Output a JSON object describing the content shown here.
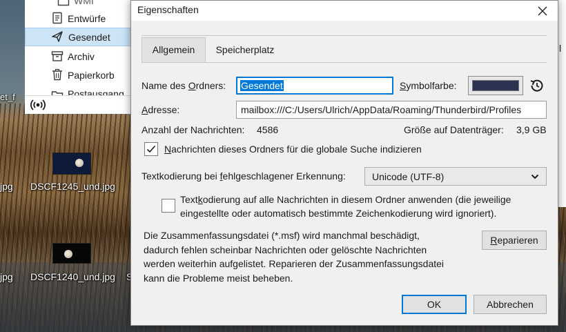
{
  "folder_pane": {
    "items": [
      {
        "label": "WMI",
        "icon": "folder-icon"
      },
      {
        "label": "Entwürfe",
        "icon": "drafts-icon"
      },
      {
        "label": "Gesendet",
        "icon": "send-icon",
        "selected": true
      },
      {
        "label": "Archiv",
        "icon": "archive-icon"
      },
      {
        "label": "Papierkorb",
        "icon": "trash-icon"
      },
      {
        "label": "Postausgang",
        "icon": "outbox-folder-icon"
      }
    ],
    "status_icon": "online-status-icon",
    "selected_color": "#cde4f7"
  },
  "desktop": {
    "icons": [
      {
        "label": "DSCF1245_und.jpg"
      },
      {
        "label": "DSCF1240_und.jpg"
      }
    ],
    "edge_labels": {
      "left_top": "et_f",
      "left_mid": "jpg",
      "left_bottom": "jpg",
      "s_fragment": "S"
    }
  },
  "bg_window": {
    "fragment": "l"
  },
  "dialog": {
    "title": "Eigenschaften",
    "close_icon": "close-icon",
    "tabs": [
      {
        "label": "Allgemein",
        "active": true
      },
      {
        "label": "Speicherplatz",
        "active": false
      }
    ],
    "name": {
      "label_pre": "Name des ",
      "label_accel": "O",
      "label_post": "rdners:",
      "value": "Gesendet"
    },
    "symbol_color": {
      "label_accel": "S",
      "label_post": "ymbolfarbe:",
      "value": "#2b3350",
      "reset_icon": "history-reset-icon"
    },
    "address": {
      "label_accel": "A",
      "label_post": "dresse:",
      "value": "mailbox:///C:/Users/Ulrich/AppData/Roaming/Thunderbird/Profiles"
    },
    "message_count": {
      "label": "Anzahl der Nachrichten:",
      "value": "4586"
    },
    "disk_size": {
      "label": "Größe auf Datenträger:",
      "value": "3,9 GB"
    },
    "index_checkbox": {
      "checked": true,
      "label_accel": "N",
      "label_post": "achrichten dieses Ordners für die globale Suche indizieren",
      "check_icon": "checkmark-icon"
    },
    "encoding": {
      "label_pre": "Textkodierung bei ",
      "label_accel": "f",
      "label_post": "ehlgeschlagener Erkennung:",
      "selected": "Unicode (UTF-8)",
      "chevron_icon": "chevron-down-icon"
    },
    "apply_encoding": {
      "checked": false,
      "line1_pre": "Text",
      "line1_accel": "k",
      "line1_post": "odierung auf alle Nachrichten in diesem Ordner anwenden (die jeweilige",
      "line2": "eingestellte oder automatisch bestimmte Zeichenkodierung wird ignoriert)."
    },
    "repair_text": [
      "Die Zusammenfassungsdatei (*.msf) wird manchmal beschädigt,",
      "dadurch fehlen scheinbar Nachrichten oder gelöschte Nachrichten",
      "werden weiterhin aufgelistet. Reparieren der Zusammenfassungsdatei",
      "kann die Probleme meist beheben."
    ],
    "repair_button": {
      "accel": "R",
      "post": "eparieren"
    },
    "ok_button": "OK",
    "cancel_button": "Abbrechen",
    "accent_color": "#0078d7"
  }
}
